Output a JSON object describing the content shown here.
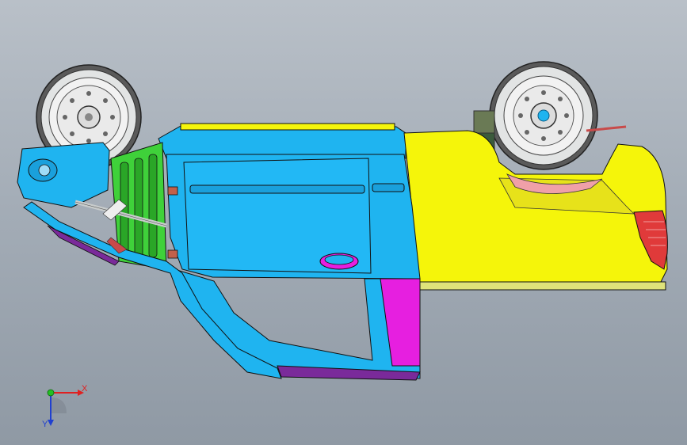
{
  "viewport": {
    "background_top": "#b9c0c8",
    "background_bottom": "#8f99a4"
  },
  "model": {
    "parts": {
      "body_side": "#1fb4f0",
      "rear_quarter": "#f5f50a",
      "inner_panel": "#e61fe0",
      "radiator": "#3fd13a",
      "tail_lamp": "#e03a3a",
      "tire": "#d8dcdc",
      "rim_hub": "#1fb4f0",
      "edge_lines": "#1a1a1a"
    }
  },
  "triad": {
    "x_label": "X",
    "y_label": "Y",
    "x_color": "#e02020",
    "y_color": "#2040d0",
    "origin_color": "#22c022",
    "icons": [
      "coordinate-triad-icon"
    ]
  }
}
